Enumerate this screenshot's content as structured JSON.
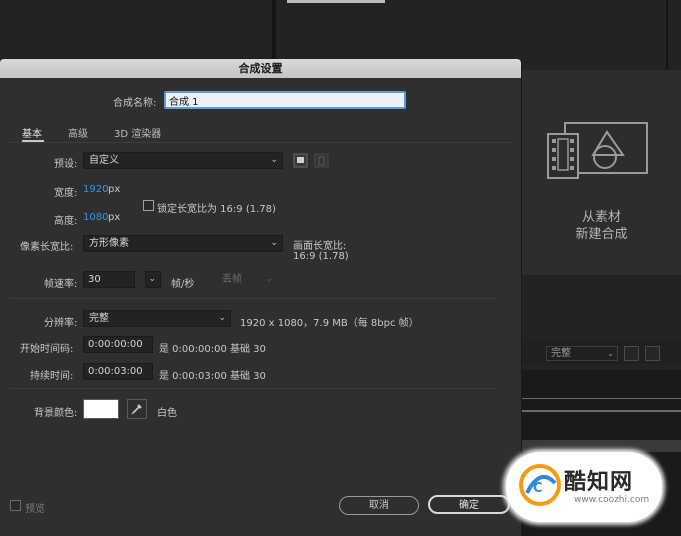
{
  "dialog": {
    "title": "合成设置",
    "name_label": "合成名称:",
    "name_value": "合成 1",
    "tabs": [
      {
        "label": "基本",
        "active": true
      },
      {
        "label": "高级",
        "active": false
      },
      {
        "label": "3D 渲染器",
        "active": false
      }
    ],
    "preset": {
      "label": "预设:",
      "value": "自定义"
    },
    "width": {
      "label": "宽度:",
      "value": "1920",
      "unit": "px"
    },
    "height": {
      "label": "高度:",
      "value": "1080",
      "unit": "px"
    },
    "lock_aspect": {
      "label": "锁定长宽比为 16:9 (1.78)",
      "checked": false
    },
    "pixel_aspect": {
      "label": "像素长宽比:",
      "value": "方形像素"
    },
    "frame_aspect": {
      "label": "画面长宽比:",
      "value": "16:9 (1.78)"
    },
    "frame_rate": {
      "label": "帧速率:",
      "value": "30",
      "unit": "帧/秒",
      "drop_frame": "丢帧"
    },
    "resolution": {
      "label": "分辨率:",
      "value": "完整",
      "info": "1920 x 1080，7.9 MB（每 8bpc 帧）"
    },
    "start_timecode": {
      "label": "开始时间码:",
      "value": "0:00:00:00",
      "info": "是 0:00:00:00 基础 30"
    },
    "duration": {
      "label": "持续时间:",
      "value": "0:00:03:00",
      "info": "是 0:00:03:00 基础 30"
    },
    "bg_color": {
      "label": "背景颜色:",
      "color": "#ffffff",
      "name": "白色"
    },
    "preview_label": "预览",
    "cancel_label": "取消",
    "ok_label": "确定"
  },
  "background_app": {
    "new_comp_line1": "从素材",
    "new_comp_line2": "新建合成",
    "viewer_quality": "完整"
  },
  "watermark": {
    "name": "酷知网",
    "url": "www.coozhi.com"
  },
  "colors": {
    "dialog_bg": "#2f2f2f",
    "accent_blue": "#3a95e8",
    "input_focus": "#5d9bd6"
  }
}
